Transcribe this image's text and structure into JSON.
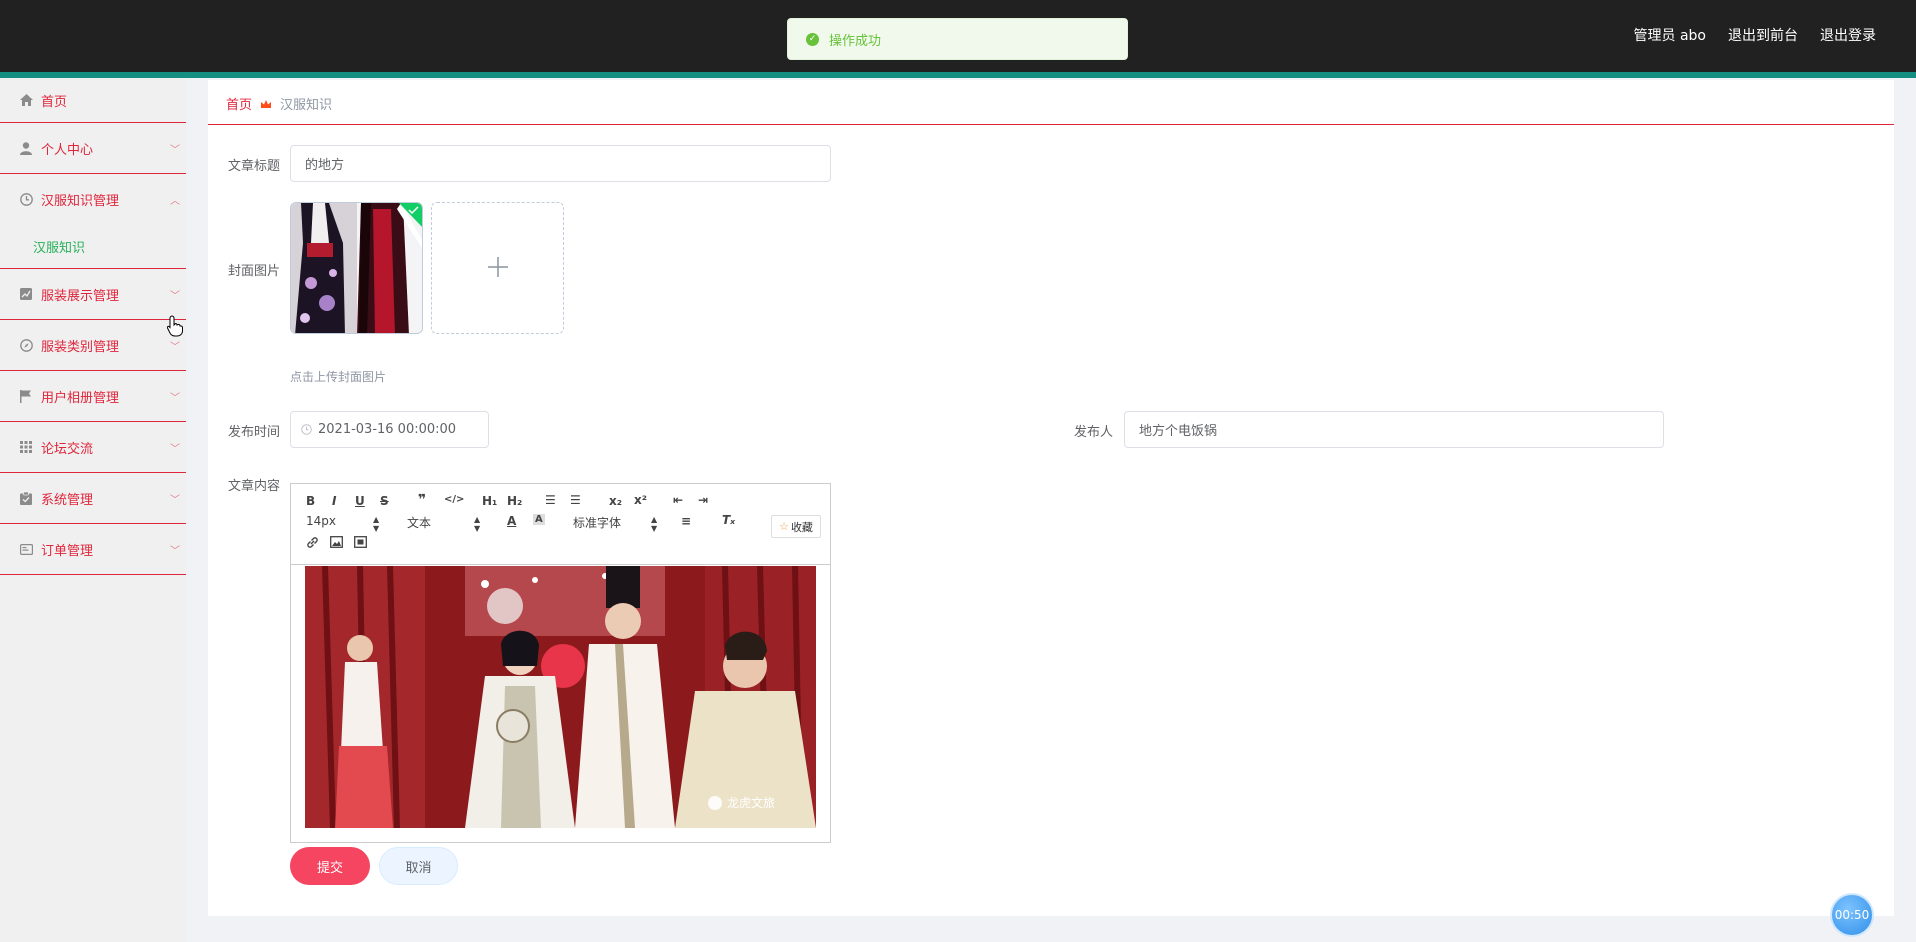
{
  "header": {
    "user_label": "管理员 abo",
    "to_front_label": "退出到前台",
    "logout_label": "退出登录"
  },
  "toast": {
    "message": "操作成功"
  },
  "sidebar": {
    "items": [
      {
        "label": "首页",
        "icon": "home-icon"
      },
      {
        "label": "个人中心",
        "icon": "user-icon"
      },
      {
        "label": "汉服知识管理",
        "icon": "clock-icon",
        "expanded": true,
        "children": [
          {
            "label": "汉服知识"
          }
        ]
      },
      {
        "label": "服装展示管理",
        "icon": "chart-icon"
      },
      {
        "label": "服装类别管理",
        "icon": "compass-icon"
      },
      {
        "label": "用户相册管理",
        "icon": "flag-icon"
      },
      {
        "label": "论坛交流",
        "icon": "grid-icon"
      },
      {
        "label": "系统管理",
        "icon": "clipboard-icon"
      },
      {
        "label": "订单管理",
        "icon": "card-icon"
      }
    ]
  },
  "breadcrumb": {
    "home": "首页",
    "current": "汉服知识"
  },
  "form": {
    "title_label": "文章标题",
    "title_value": "的地方",
    "cover_label": "封面图片",
    "cover_tip": "点击上传封面图片",
    "publish_time_label": "发布时间",
    "publish_time_value": "2021-03-16 00:00:00",
    "publisher_label": "发布人",
    "publisher_value": "地方个电饭锅",
    "content_label": "文章内容",
    "editor": {
      "font_size": "14px",
      "header_select": "文本",
      "font_family": "标准字体",
      "favorite_label": "收藏",
      "image_caption": "龙虎文旅"
    },
    "submit_label": "提交",
    "cancel_label": "取消"
  },
  "timer": "00:50",
  "colors": {
    "accent": "#e0263c",
    "teal": "#168f83",
    "topbar": "#212121",
    "submit": "#f54560"
  }
}
